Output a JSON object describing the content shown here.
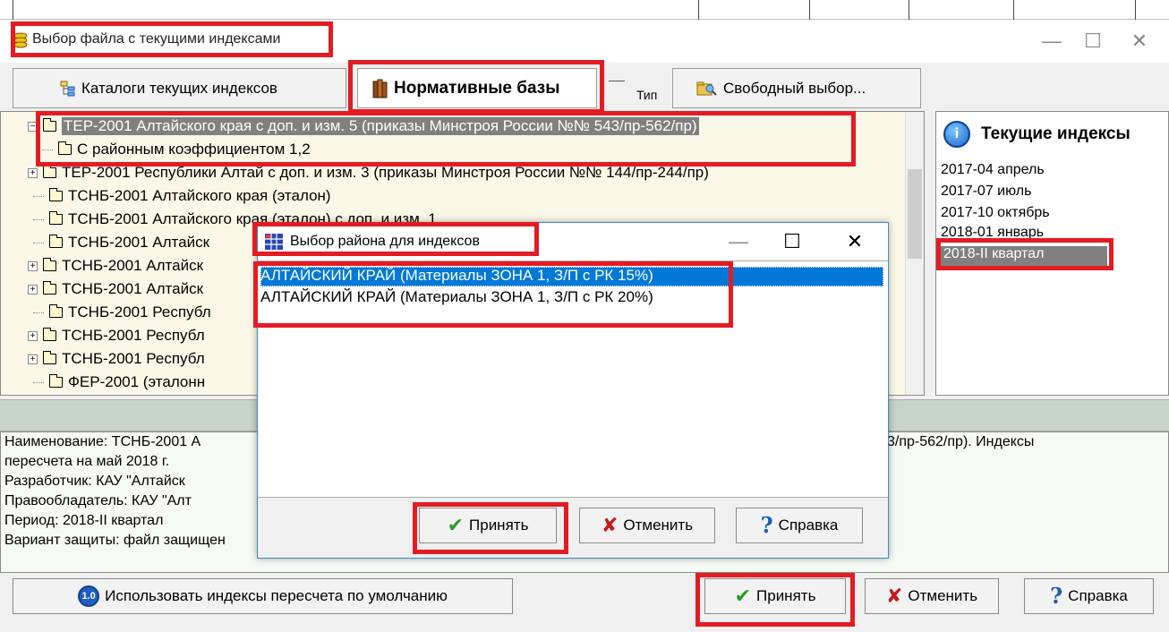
{
  "main_window": {
    "title": "Выбор файла с текущими индексами",
    "minimize": "—",
    "maximize": "☐",
    "close": "✕"
  },
  "tabs": {
    "catalogs": "Каталоги текущих индексов",
    "norm_bases": "Нормативные базы",
    "type_label": "Тип",
    "free_choice": "Свободный выбор..."
  },
  "tree": {
    "items": [
      "ТЕР-2001 Алтайского края с доп. и изм. 5 (приказы Минстроя России №№ 543/пр-562/пр)",
      "С районным коэффициентом 1,2",
      "ТЕР-2001 Республики Алтай с доп. и изм. 3 (приказы Минстроя России №№ 144/пр-244/пр)",
      "ТСНБ-2001 Алтайского края (эталон)",
      "ТСНБ-2001 Алтайского края (эталон) с доп. и изм. 1",
      "ТСНБ-2001 Алтайск",
      "ТСНБ-2001 Алтайск",
      "ТСНБ-2001 Алтайск",
      "ТСНБ-2001 Республ",
      "ТСНБ-2001 Республ",
      "ТСНБ-2001 Республ",
      "ФЕР-2001 (эталонн"
    ]
  },
  "indexes": {
    "title": "Текущие индексы",
    "icon_text": "i",
    "items": [
      "2017-04 апрель",
      "2017-07 июль",
      "2017-10 октябрь",
      "2018-01 январь",
      "2018-II квартал"
    ]
  },
  "info": {
    "line1_left": "Наименование: ТСНБ-2001 А",
    "line1_right": "3/пр-562/пр). Индексы",
    "line2": "пересчета на май 2018 г.",
    "line3": "Разработчик: КАУ \"Алтайск",
    "line4": "Правообладатель: КАУ \"Алт",
    "line5": "Период: 2018-II квартал",
    "line6": "Вариант защиты: файл защищен"
  },
  "bottom": {
    "default_label": "Использовать индексы пересчета по умолчанию",
    "default_badge": "1.0",
    "accept": "Принять",
    "cancel": "Отменить",
    "help": "Справка"
  },
  "dialog": {
    "title": "Выбор района для индексов",
    "items": [
      "АЛТАЙСКИЙ КРАЙ (Материалы ЗОНА 1, З/П с РК 15%)",
      "АЛТАЙСКИЙ КРАЙ (Материалы ЗОНА 1, З/П с РК 20%)"
    ],
    "accept": "Принять",
    "cancel": "Отменить",
    "help": "Справка"
  },
  "icons": {
    "check": "✔",
    "cross": "✘",
    "question": "?"
  },
  "colors": {
    "highlight": "#e41b23",
    "selection_blue": "#0078d7",
    "selection_gray": "#808080",
    "tree_bg": "#fcf8e8",
    "status_strip": "#c7d5c9"
  }
}
